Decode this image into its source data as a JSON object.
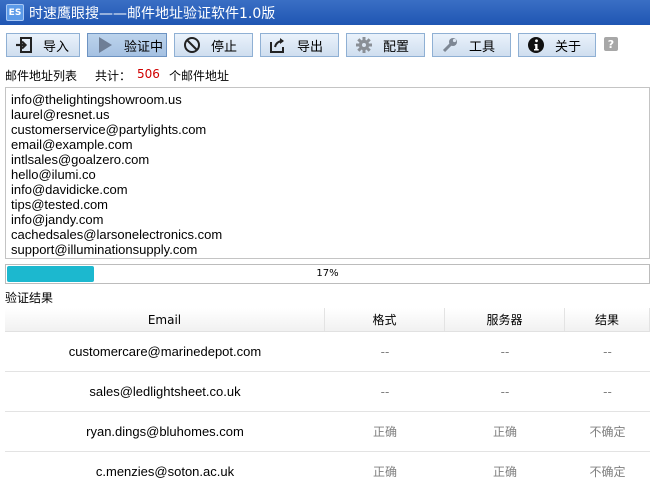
{
  "window": {
    "icon_text": "ES",
    "title": "时速鹰眼搜——邮件地址验证软件1.0版"
  },
  "toolbar": {
    "buttons": [
      {
        "label": "导入",
        "icon": "import-icon"
      },
      {
        "label": "验证中",
        "icon": "play-icon"
      },
      {
        "label": "停止",
        "icon": "stop-icon"
      },
      {
        "label": "导出",
        "icon": "export-icon"
      },
      {
        "label": "配置",
        "icon": "gear-icon"
      },
      {
        "label": "工具",
        "icon": "tools-icon"
      },
      {
        "label": "关于",
        "icon": "info-icon"
      }
    ],
    "help_label": "?"
  },
  "email_list": {
    "title": "邮件地址列表",
    "count_prefix": "共计：",
    "count": "506",
    "count_suffix": "个邮件地址",
    "emails": [
      "info@thelightingshowroom.us",
      "laurel@resnet.us",
      "customerservice@partylights.com",
      "email@example.com",
      "intlsales@goalzero.com",
      "hello@ilumi.co",
      "info@davidicke.com",
      "tips@tested.com",
      "info@jandy.com",
      "cachedsales@larsonelectronics.com",
      "support@illuminationsupply.com"
    ]
  },
  "progress": {
    "value": 0.17,
    "label": "17%",
    "color": "#1cb8cf"
  },
  "results": {
    "title": "验证结果",
    "columns": [
      "Email",
      "格式",
      "服务器",
      "结果"
    ],
    "rows": [
      {
        "email": "customercare@marinedepot.com",
        "format": "--",
        "server": "--",
        "result": "--"
      },
      {
        "email": "sales@ledlightsheet.co.uk",
        "format": "--",
        "server": "--",
        "result": "--"
      },
      {
        "email": "ryan.dings@bluhomes.com",
        "format": "正确",
        "server": "正确",
        "result": "不确定"
      },
      {
        "email": "c.menzies@soton.ac.uk",
        "format": "正确",
        "server": "正确",
        "result": "不确定"
      }
    ]
  },
  "colors": {
    "titlebar": "#1f56b3",
    "count": "#d00000",
    "progress": "#1cb8cf"
  }
}
